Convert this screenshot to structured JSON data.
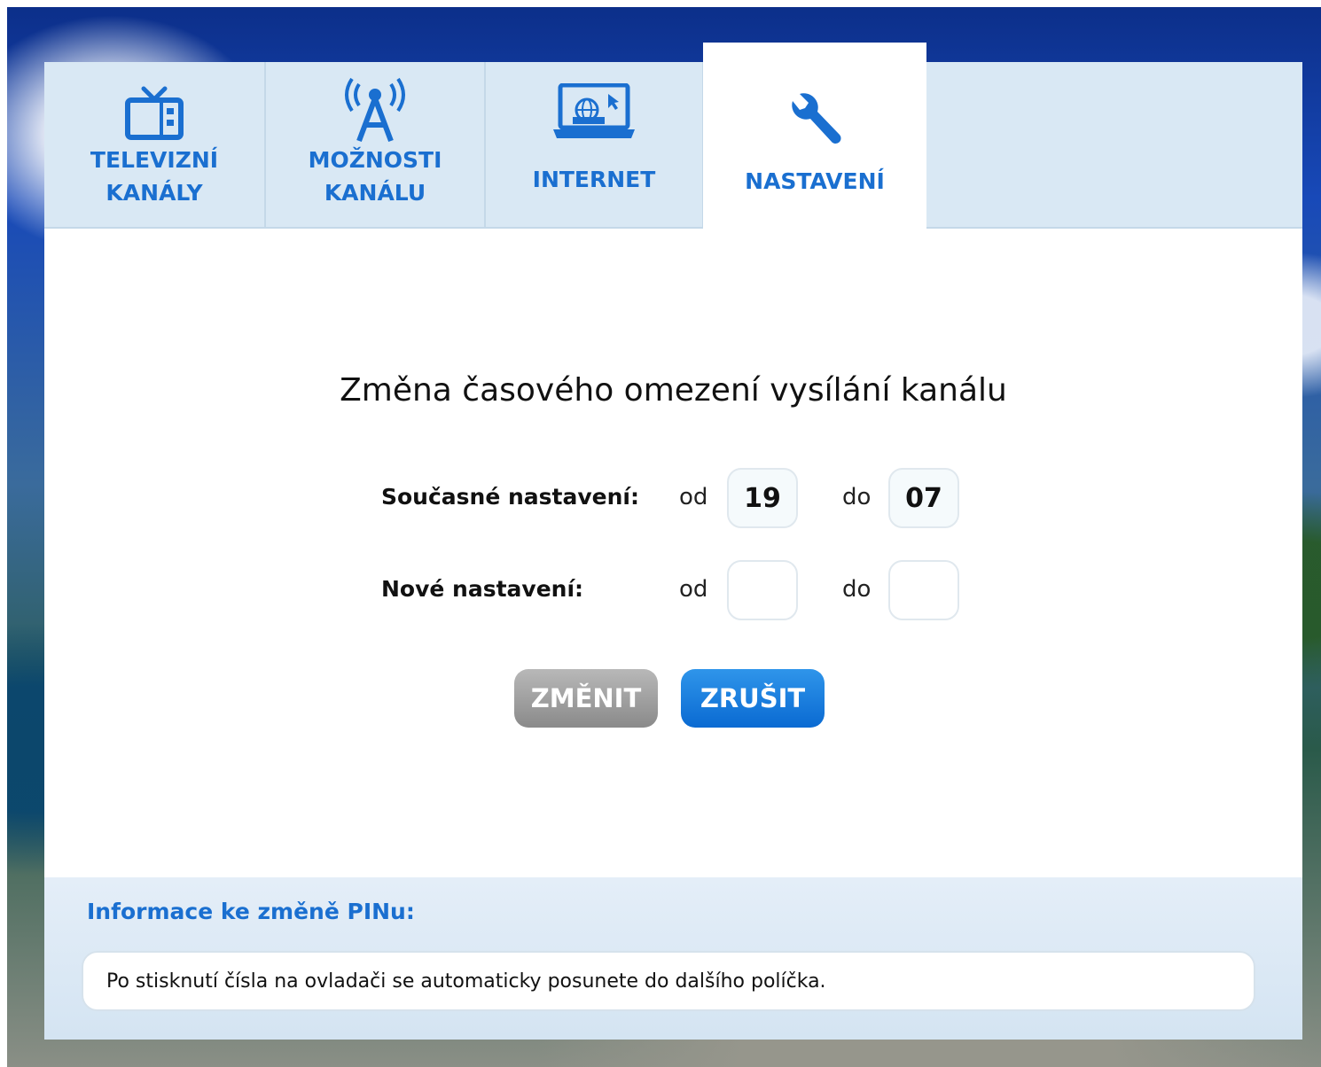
{
  "tabs": [
    {
      "label": "TELEVIZNÍ\nKANÁLY",
      "icon": "tv-icon"
    },
    {
      "label": "MOŽNOSTI\nKANÁLU",
      "icon": "antenna-icon"
    },
    {
      "label": "INTERNET",
      "icon": "laptop-globe-icon"
    },
    {
      "label": "NASTAVENÍ",
      "icon": "wrench-icon",
      "active": true
    }
  ],
  "main": {
    "title": "Změna časového omezení vysílání kanálu",
    "current": {
      "label": "Současné nastavení:",
      "from_word": "od",
      "to_word": "do",
      "from_value": "19",
      "to_value": "07"
    },
    "new": {
      "label": "Nové nastavení:",
      "from_word": "od",
      "to_word": "do",
      "from_value": "",
      "to_value": ""
    },
    "change_button": "ZMĚNIT",
    "cancel_button": "ZRUŠIT"
  },
  "info": {
    "heading": "Informace ke změně PINu:",
    "text": "Po stisknutí čísla na ovladači se automaticky posunete do dalšího políčka."
  },
  "colors": {
    "accent": "#1a6fd0",
    "cancel_button": "#0a6ad2",
    "change_button_disabled": "#9a9a9a",
    "tab_bg": "#d9e8f4"
  }
}
